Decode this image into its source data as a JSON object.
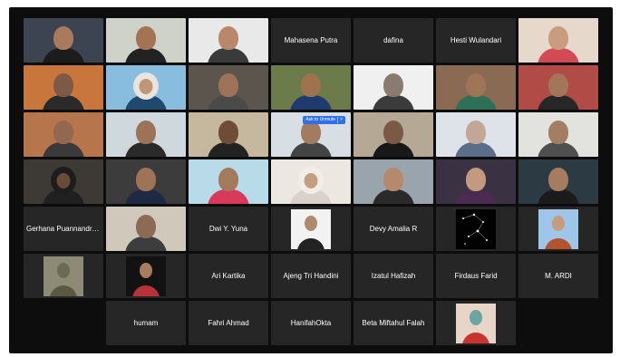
{
  "meeting": {
    "unmute_label": "Ask to Unmute",
    "colors": {
      "background": "#0d0d0d",
      "tile": "#262626",
      "active_speaker": "#2ec24a",
      "unmute_button": "#2f6fe8"
    },
    "rows": [
      [
        {
          "type": "video",
          "bg": "#3c4452",
          "skin": "#a97a5c",
          "shirt": "#1c1c1c",
          "hijab": false
        },
        {
          "type": "video",
          "bg": "#cfd2c8",
          "skin": "#a37454",
          "shirt": "#222",
          "hijab": false
        },
        {
          "type": "video",
          "bg": "#e9e9e9",
          "skin": "#b9876a",
          "shirt": "#3a3a3a",
          "hijab": false
        },
        {
          "type": "name",
          "name": "Mahasena Putra"
        },
        {
          "type": "name",
          "name": "dafina"
        },
        {
          "type": "name",
          "name": "Hesti Wulandari"
        },
        {
          "type": "video",
          "bg": "#e6d9cc",
          "skin": "#c99c80",
          "shirt": "#d44a54",
          "hijab": false,
          "active": true
        }
      ],
      [
        {
          "type": "video",
          "bg": "#c9763c",
          "skin": "#7d5a46",
          "shirt": "#2a2a2a",
          "hijab": false
        },
        {
          "type": "video",
          "bg": "#89bde0",
          "skin": "#c19677",
          "shirt": "#1f4a6d",
          "hijab": true,
          "hijabColor": "#e9e4dc"
        },
        {
          "type": "video",
          "bg": "#5b554d",
          "skin": "#9d7458",
          "shirt": "#4a4a4a",
          "hijab": false
        },
        {
          "type": "video",
          "bg": "#6b7b4a",
          "skin": "#a0734f",
          "shirt": "#1f3a6e",
          "hijab": false
        },
        {
          "type": "video",
          "bg": "#f0f0f0",
          "skin": "#8b7b6e",
          "shirt": "#3b3b3b",
          "hijab": false
        },
        {
          "type": "video",
          "bg": "#8a6a52",
          "skin": "#9e7556",
          "shirt": "#2e6f58",
          "hijab": false
        },
        {
          "type": "video",
          "bg": "#b04b46",
          "skin": "#a3765a",
          "shirt": "#272727",
          "hijab": false
        },
        {
          "type": "video",
          "bg": "#d4c9b0",
          "skin": "#a57b5e",
          "shirt": "#5c2e36",
          "hijab": true,
          "hijabColor": "#6a3a3e"
        }
      ],
      [
        {
          "type": "video",
          "bg": "#b7754c",
          "skin": "#946750",
          "shirt": "#3a3a3a",
          "hijab": false
        },
        {
          "type": "video",
          "bg": "#cfd8dd",
          "skin": "#9c7356",
          "shirt": "#2a2a2a",
          "hijab": false
        },
        {
          "type": "video",
          "bg": "#c6b89e",
          "skin": "#6f4c37",
          "shirt": "#222",
          "hijab": false
        },
        {
          "type": "video",
          "bg": "#d8dfe4",
          "skin": "#a27b61",
          "shirt": "#444",
          "hijab": false,
          "unmute": true
        },
        {
          "type": "video",
          "bg": "#b5a894",
          "skin": "#7a5a45",
          "shirt": "#181818",
          "hijab": false
        },
        {
          "type": "video",
          "bg": "#dde3e8",
          "skin": "#c2a794",
          "shirt": "#5b6d8b",
          "hijab": false
        },
        {
          "type": "video",
          "bg": "#e2e2de",
          "skin": "#a37e63",
          "shirt": "#4f4f4f",
          "hijab": false
        }
      ],
      [
        {
          "type": "video",
          "bg": "#3d3a36",
          "skin": "#6a4a39",
          "shirt": "#202020",
          "hijab": true,
          "hijabColor": "#1d1d1d"
        },
        {
          "type": "video",
          "bg": "#3c3c3c",
          "skin": "#9e7457",
          "shirt": "#1e2a44",
          "hijab": false
        },
        {
          "type": "video",
          "bg": "#b7dbe8",
          "skin": "#a47a5d",
          "shirt": "#d93a5c",
          "hijab": false
        },
        {
          "type": "video",
          "bg": "#ece7e1",
          "skin": "#c49e83",
          "shirt": "#d8d2cb",
          "hijab": true,
          "hijabColor": "#f1ede7"
        },
        {
          "type": "video",
          "bg": "#9aa4ac",
          "skin": "#b5896c",
          "shirt": "#2a2a2a",
          "hijab": false
        },
        {
          "type": "video",
          "bg": "#3a3242",
          "skin": "#c39a80",
          "shirt": "#4b2b52",
          "hijab": false
        },
        {
          "type": "video",
          "bg": "#2c3a44",
          "skin": "#a67c5e",
          "shirt": "#1b1b1b",
          "hijab": false
        }
      ],
      [
        {
          "type": "name",
          "name": "Gerhana Puannandra Putri"
        },
        {
          "type": "video",
          "bg": "#cfc8bb",
          "skin": "#8d6a55",
          "shirt": "#3d3d3d",
          "hijab": false
        },
        {
          "type": "name",
          "name": "Dwi Y. Yuna"
        },
        {
          "type": "avatar",
          "bg": "#f2f2f2",
          "skin": "#b08a6e",
          "shirt": "#222"
        },
        {
          "type": "name",
          "name": "Devy Amalia R"
        },
        {
          "type": "stars"
        },
        {
          "type": "avatar",
          "bg": "#9fc6e8",
          "skin": "#c69c7c",
          "shirt": "#b3542e"
        }
      ],
      [
        {
          "type": "avatar",
          "bg": "#8d8a76",
          "skin": "#6b6a52",
          "shirt": "#5b5a40"
        },
        {
          "type": "avatar",
          "bg": "#121212",
          "skin": "#a87c5c",
          "shirt": "#b8323a"
        },
        {
          "type": "name",
          "name": "Ari Kartika"
        },
        {
          "type": "name",
          "name": "Ajeng Tri Handini"
        },
        {
          "type": "name",
          "name": "Izatul Hafizah"
        },
        {
          "type": "name",
          "name": "Firdaus Farid"
        },
        {
          "type": "name",
          "name": "M. ARDI"
        }
      ],
      [
        {
          "type": "empty"
        },
        {
          "type": "name",
          "name": "humam"
        },
        {
          "type": "name",
          "name": "Fahri Ahmad"
        },
        {
          "type": "name",
          "name": "HanifahOkta"
        },
        {
          "type": "name",
          "name": "Beta Miftahul Falah"
        },
        {
          "type": "avatar",
          "bg": "#e7d6c8",
          "skin": "#6aa5a0",
          "shirt": "#c9342f"
        },
        {
          "type": "empty"
        }
      ]
    ]
  }
}
